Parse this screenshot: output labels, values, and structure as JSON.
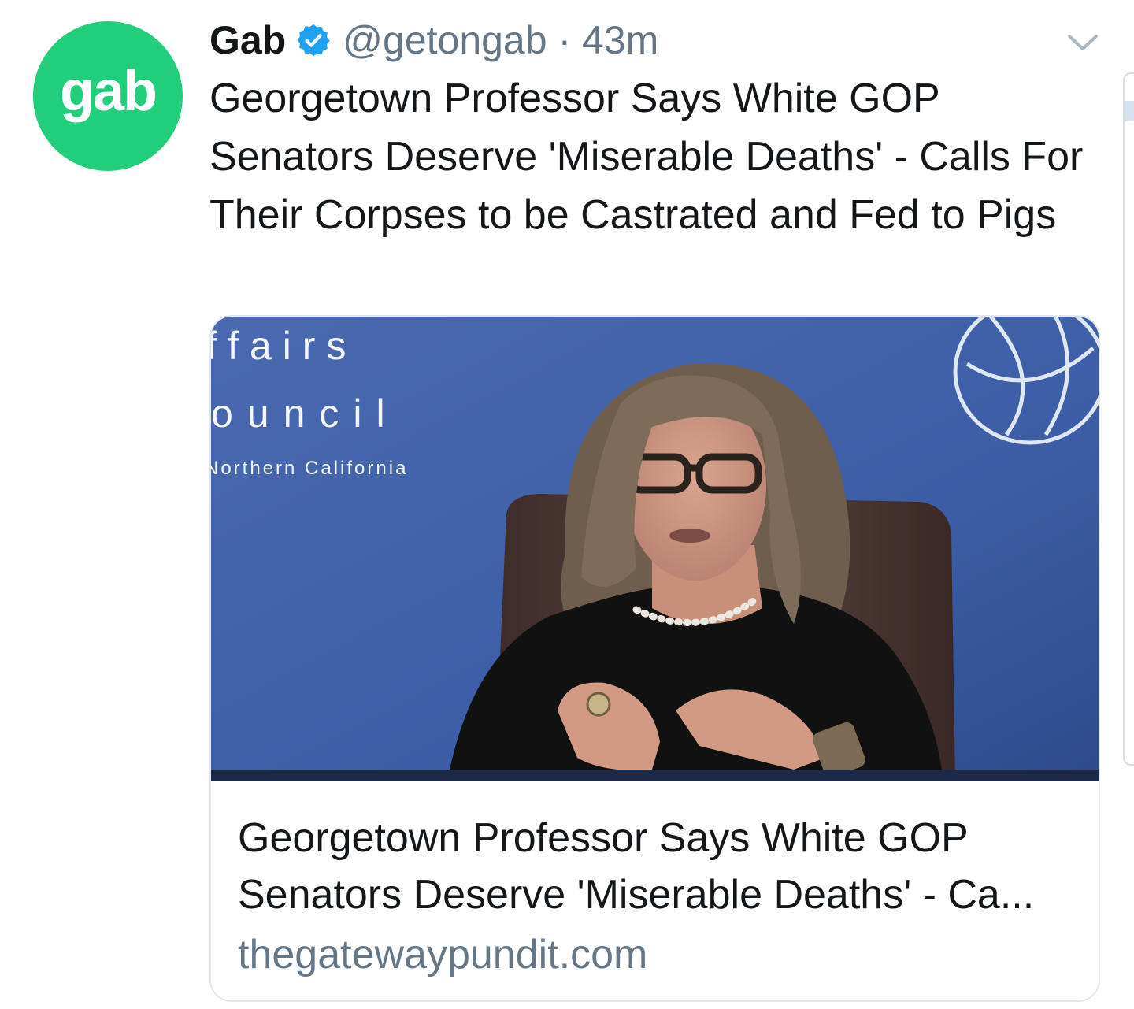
{
  "avatar": {
    "text": "gab",
    "color": "#21cf7a"
  },
  "header": {
    "display_name": "Gab",
    "verified_icon": "verified-badge-icon",
    "handle_time": "@getongab · 43m",
    "menu_icon": "chevron-down-icon"
  },
  "tweet": {
    "text": "Georgetown Professor Says White GOP Senators Deserve 'Miserable Deaths' - Calls For Their Corpses to be Castrated and Fed to Pigs"
  },
  "card": {
    "image": {
      "backdrop_text_1": "ffairs",
      "backdrop_text_2": "ouncil",
      "backdrop_text_3": "Northern California"
    },
    "title_line_1": "Georgetown Professor Says White GOP",
    "title_line_2": "Senators Deserve 'Miserable Deaths' - Ca...",
    "domain": "thegatewaypundit.com"
  },
  "colors": {
    "text_primary": "#14171a",
    "text_secondary": "#657786",
    "verified_blue": "#1da1f2",
    "card_border": "#e1e8ed"
  }
}
